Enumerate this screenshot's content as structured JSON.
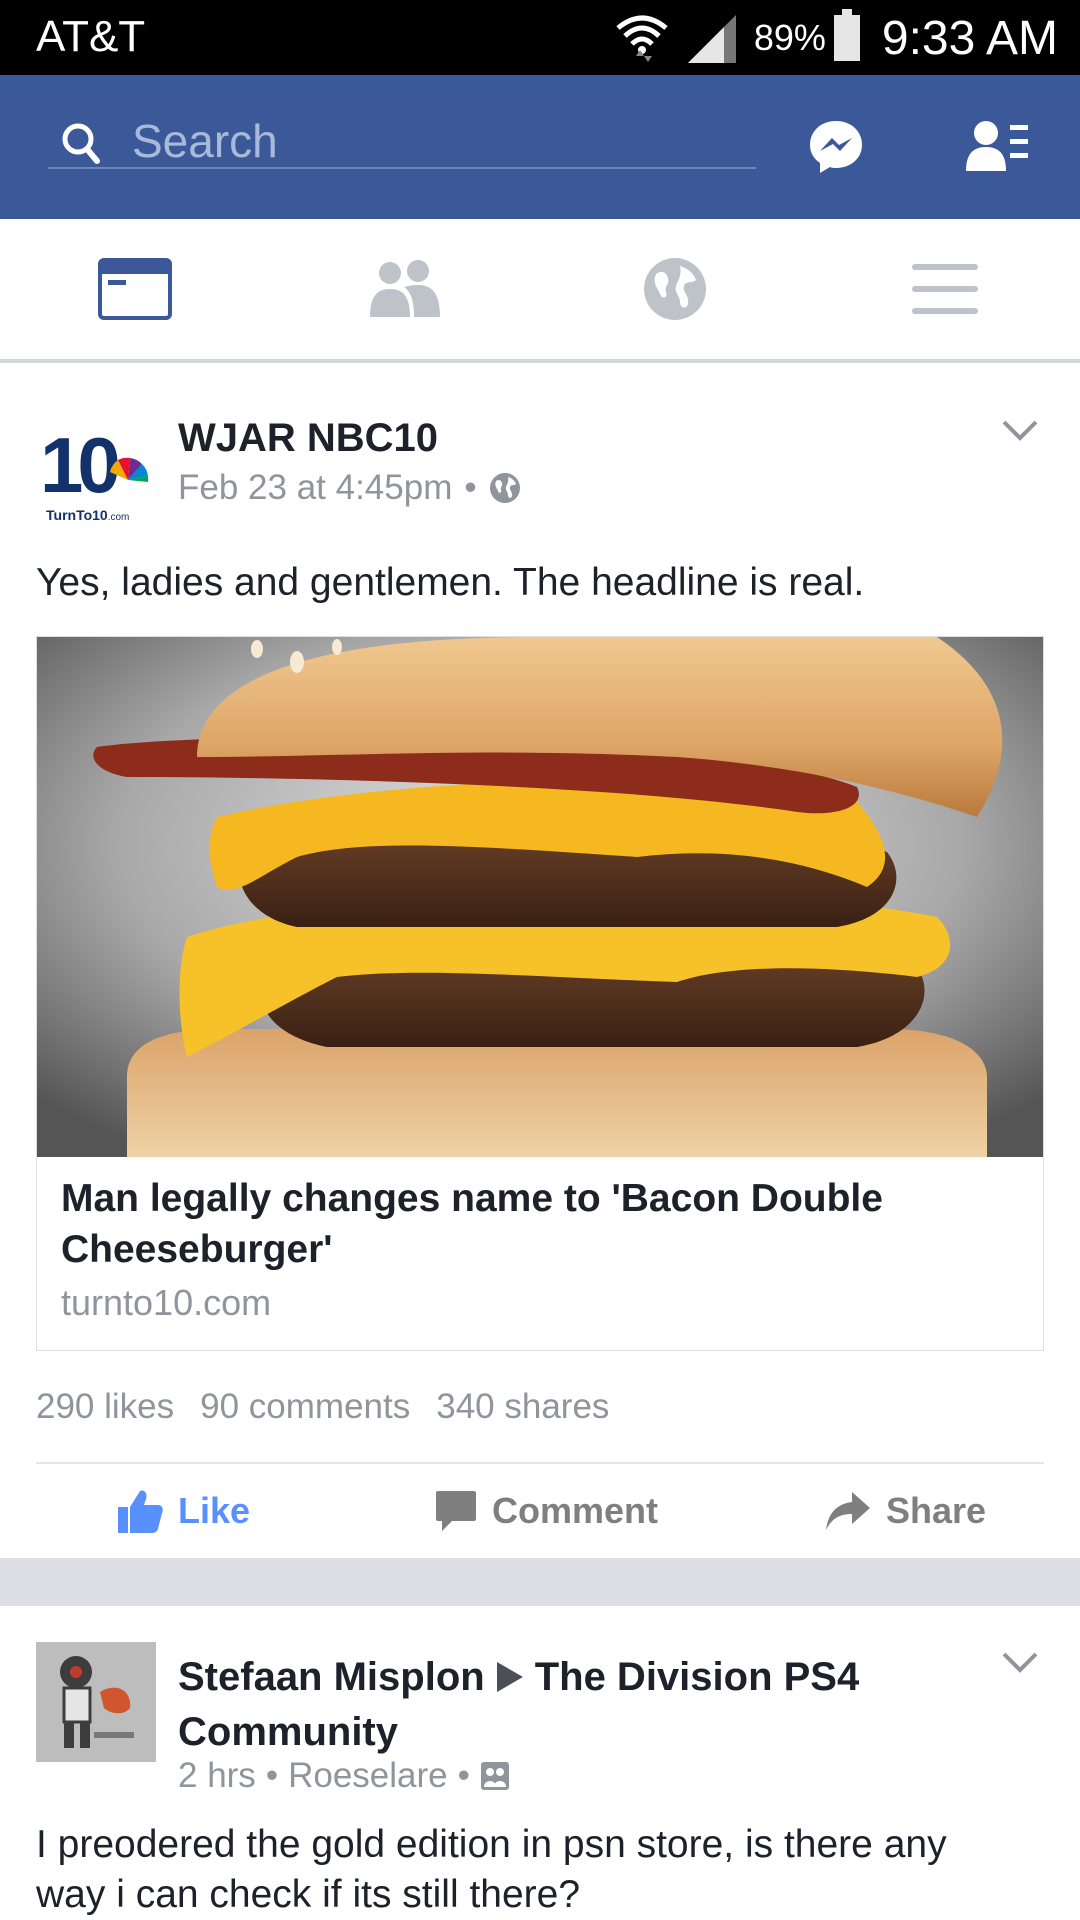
{
  "status_bar": {
    "carrier": "AT&T",
    "battery": "89%",
    "time": "9:33 AM"
  },
  "header": {
    "search_placeholder": "Search"
  },
  "nav_tabs": [
    "News Feed",
    "Friend Requests",
    "Notifications",
    "More"
  ],
  "posts": [
    {
      "author": "WJAR NBC10",
      "avatar_text": "TurnTo10.com",
      "timestamp": "Feb 23 at 4:45pm",
      "privacy": "globe-icon",
      "text": "Yes, ladies and gentlemen. The headline is real.",
      "link": {
        "title": "Man legally changes name to 'Bacon Double Cheeseburger'",
        "domain": "turnto10.com"
      },
      "counts": {
        "likes": "290 likes",
        "comments": "90 comments",
        "shares": "340 shares"
      },
      "actions": {
        "like": "Like",
        "comment": "Comment",
        "share": "Share"
      }
    },
    {
      "author": "Stefaan Misplon",
      "group": "The Division PS4 Community",
      "timestamp": "2 hrs",
      "location": "Roeselare",
      "privacy": "group-icon",
      "text_line1": "I preodered the gold edition in psn store, is there any",
      "text_line2": "way i can check if its still there?"
    }
  ],
  "colors": {
    "header_bg": "#3b5998",
    "like_blue": "#5890ff",
    "meta_gray": "#90949c"
  }
}
